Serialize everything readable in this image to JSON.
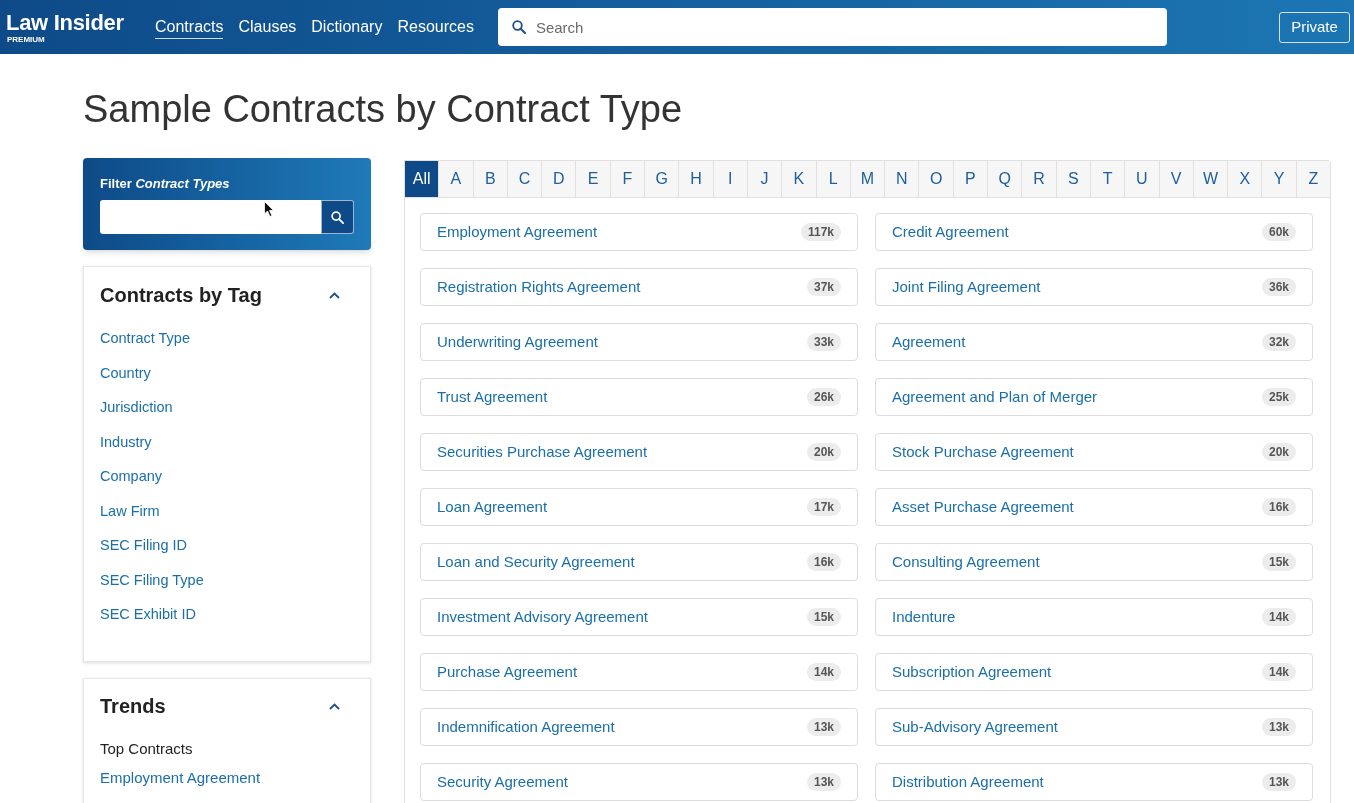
{
  "header": {
    "logo": "Law Insider",
    "logo_tagline": "PREMIUM",
    "nav": [
      {
        "label": "Contracts",
        "selected": true
      },
      {
        "label": "Clauses",
        "selected": false
      },
      {
        "label": "Dictionary",
        "selected": false
      },
      {
        "label": "Resources",
        "selected": false
      }
    ],
    "search": {
      "placeholder": "Search"
    },
    "private_button": "Private"
  },
  "page_title": "Sample Contracts by Contract Type",
  "filter": {
    "title": "Filter *Contract Types*"
  },
  "tag_panel": {
    "title": "Contracts by Tag",
    "expanded": true,
    "links": [
      "Contract Type",
      "Country",
      "Jurisdiction",
      "Industry",
      "Company",
      "Law Firm",
      "SEC Filing ID",
      "SEC Filing Type",
      "SEC Exhibit ID"
    ]
  },
  "trends_panel": {
    "title": "Trends",
    "expanded": true,
    "subheading": "Top Contracts",
    "links": [
      "Employment Agreement"
    ]
  },
  "letters": [
    {
      "label": "All",
      "selected": true
    },
    {
      "label": "A",
      "selected": false
    },
    {
      "label": "B",
      "selected": false
    },
    {
      "label": "C",
      "selected": false
    },
    {
      "label": "D",
      "selected": false
    },
    {
      "label": "E",
      "selected": false
    },
    {
      "label": "F",
      "selected": false
    },
    {
      "label": "G",
      "selected": false
    },
    {
      "label": "H",
      "selected": false
    },
    {
      "label": "I",
      "selected": false
    },
    {
      "label": "J",
      "selected": false
    },
    {
      "label": "K",
      "selected": false
    },
    {
      "label": "L",
      "selected": false
    },
    {
      "label": "M",
      "selected": false
    },
    {
      "label": "N",
      "selected": false
    },
    {
      "label": "O",
      "selected": false
    },
    {
      "label": "P",
      "selected": false
    },
    {
      "label": "Q",
      "selected": false
    },
    {
      "label": "R",
      "selected": false
    },
    {
      "label": "S",
      "selected": false
    },
    {
      "label": "T",
      "selected": false
    },
    {
      "label": "U",
      "selected": false
    },
    {
      "label": "V",
      "selected": false
    },
    {
      "label": "W",
      "selected": false
    },
    {
      "label": "X",
      "selected": false
    },
    {
      "label": "Y",
      "selected": false
    },
    {
      "label": "Z",
      "selected": false
    }
  ],
  "contracts": [
    {
      "name": "Employment Agreement",
      "count": "117k"
    },
    {
      "name": "Credit Agreement",
      "count": "60k"
    },
    {
      "name": "Registration Rights Agreement",
      "count": "37k"
    },
    {
      "name": "Joint Filing Agreement",
      "count": "36k"
    },
    {
      "name": "Underwriting Agreement",
      "count": "33k"
    },
    {
      "name": "Agreement",
      "count": "32k"
    },
    {
      "name": "Trust Agreement",
      "count": "26k"
    },
    {
      "name": "Agreement and Plan of Merger",
      "count": "25k"
    },
    {
      "name": "Securities Purchase Agreement",
      "count": "20k"
    },
    {
      "name": "Stock Purchase Agreement",
      "count": "20k"
    },
    {
      "name": "Loan Agreement",
      "count": "17k"
    },
    {
      "name": "Asset Purchase Agreement",
      "count": "16k"
    },
    {
      "name": "Loan and Security Agreement",
      "count": "16k"
    },
    {
      "name": "Consulting Agreement",
      "count": "15k"
    },
    {
      "name": "Investment Advisory Agreement",
      "count": "15k"
    },
    {
      "name": "Indenture",
      "count": "14k"
    },
    {
      "name": "Purchase Agreement",
      "count": "14k"
    },
    {
      "name": "Subscription Agreement",
      "count": "14k"
    },
    {
      "name": "Indemnification Agreement",
      "count": "13k"
    },
    {
      "name": "Sub-Advisory Agreement",
      "count": "13k"
    },
    {
      "name": "Security Agreement",
      "count": "13k"
    },
    {
      "name": "Distribution Agreement",
      "count": "13k"
    }
  ]
}
